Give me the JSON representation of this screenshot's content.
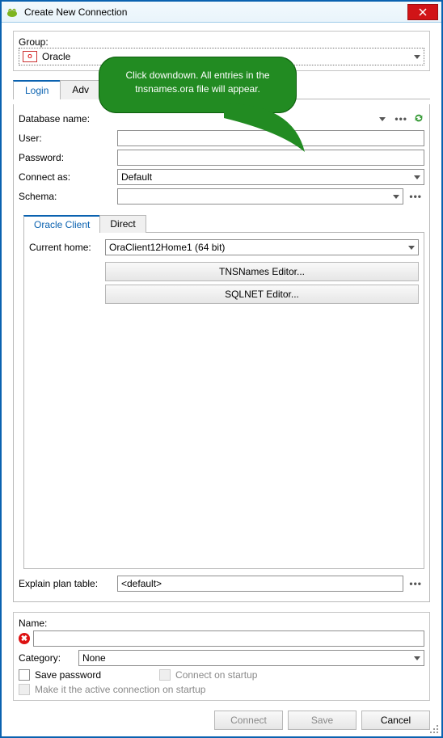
{
  "window": {
    "title": "Create New Connection"
  },
  "group": {
    "label": "Group:",
    "value": "Oracle"
  },
  "tabs": {
    "login": "Login",
    "advanced": "Adv"
  },
  "fields": {
    "database_name": {
      "label": "Database name:",
      "value": ""
    },
    "user": {
      "label": "User:",
      "value": ""
    },
    "password": {
      "label": "Password:",
      "value": ""
    },
    "connect_as": {
      "label": "Connect as:",
      "value": "Default"
    },
    "schema": {
      "label": "Schema:",
      "value": ""
    },
    "current_home": {
      "label": "Current home:",
      "value": "OraClient12Home1 (64 bit)"
    },
    "explain_plan": {
      "label": "Explain plan table:",
      "value": "<default>"
    }
  },
  "inner_tabs": {
    "oracle_client": "Oracle Client",
    "direct": "Direct"
  },
  "editor_buttons": {
    "tnsnames": "TNSNames Editor...",
    "sqlnet": "SQLNET Editor..."
  },
  "name_section": {
    "label": "Name:",
    "value": "",
    "category_label": "Category:",
    "category_value": "None",
    "save_password": "Save password",
    "connect_startup": "Connect on startup",
    "active_startup": "Make it the active connection on startup"
  },
  "buttons": {
    "connect": "Connect",
    "save": "Save",
    "cancel": "Cancel"
  },
  "speech": {
    "text": "Click downdown. All entries in the tnsnames.ora file will appear."
  }
}
